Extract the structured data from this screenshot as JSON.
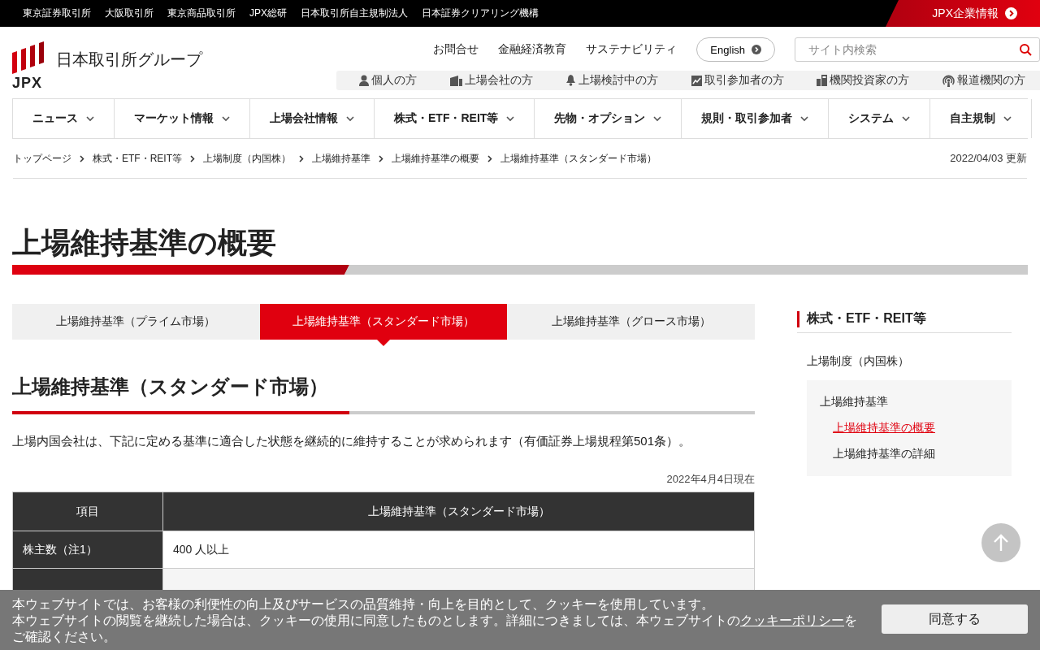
{
  "top_links": [
    "東京証券取引所",
    "大阪取引所",
    "東京商品取引所",
    "JPX総研",
    "日本取引所自主規制法人",
    "日本証券クリアリング機構"
  ],
  "corporate_link": "JPX企業情報",
  "logo": {
    "mark": "JPX",
    "name": "日本取引所グループ"
  },
  "utility_links": [
    "お問合せ",
    "金融経済教育",
    "サステナビリティ"
  ],
  "language_button": "English",
  "search": {
    "placeholder": "サイト内検索"
  },
  "audience_links": [
    {
      "label": "個人の方",
      "kind": "person"
    },
    {
      "label": "上場会社の方",
      "kind": "building"
    },
    {
      "label": "上場検討中の方",
      "kind": "bell"
    },
    {
      "label": "取引参加者の方",
      "kind": "chart"
    },
    {
      "label": "機関投資家の方",
      "kind": "device"
    },
    {
      "label": "報道機関の方",
      "kind": "broadcast"
    }
  ],
  "nav": [
    "ニュース",
    "マーケット情報",
    "上場会社情報",
    "株式・ETF・REIT等",
    "先物・オプション",
    "規則・取引参加者",
    "システム",
    "自主規制"
  ],
  "breadcrumb": [
    "トップページ",
    "株式・ETF・REIT等",
    "上場制度（内国株）",
    "上場維持基準",
    "上場維持基準の概要",
    "上場維持基準（スタンダード市場）"
  ],
  "updated": "2022/04/03 更新",
  "title": "上場維持基準の概要",
  "tabs": [
    {
      "label": "上場維持基準（プライム市場）",
      "selected": false
    },
    {
      "label": "上場維持基準（スタンダード市場）",
      "selected": true
    },
    {
      "label": "上場維持基準（グロース市場）",
      "selected": false
    }
  ],
  "section_title": "上場維持基準（スタンダード市場）",
  "intro": "上場内国会社は、下記に定める基準に適合した状態を継続的に維持することが求められます（有価証券上場規程第501条）。",
  "as_of": "2022年4月4日現在",
  "table": {
    "columns": [
      "項目",
      "上場維持基準（スタンダード市場）"
    ],
    "rows": [
      [
        "株主数（注1）",
        "400 人以上"
      ]
    ]
  },
  "sidebar": {
    "title": "株式・ETF・REIT等",
    "items": [
      {
        "label": "上場制度（内国株）",
        "children": [
          {
            "label": "上場維持基準",
            "children": [
              {
                "label": "上場維持基準の概要",
                "selected": true
              },
              {
                "label": "上場維持基準の詳細",
                "selected": false
              }
            ]
          }
        ]
      }
    ]
  },
  "cookie": {
    "line1": "本ウェブサイトでは、お客様の利便性の向上及びサービスの品質維持・向上を目的として、クッキーを使用しています。",
    "line2_before": "本ウェブサイトの閲覧を継続した場合は、クッキーの使用に同意したものとします。詳細につきましては、本ウェブサイトの",
    "link": "クッキーポリシー",
    "line2_after": "をご確認ください。",
    "button": "同意する"
  }
}
